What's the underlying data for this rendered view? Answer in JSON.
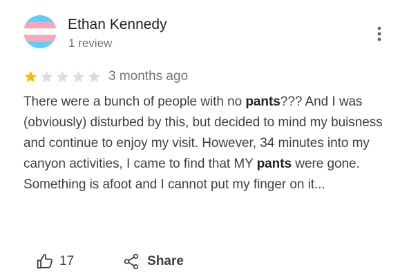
{
  "reviewer": {
    "name": "Ethan Kennedy",
    "review_count": "1 review",
    "avatar_colors": [
      "#5bcefa",
      "#f5a9b8",
      "#ffffff",
      "#f5a9b8",
      "#5bcefa"
    ]
  },
  "review": {
    "rating": 1,
    "max_rating": 5,
    "time_ago": "3 months ago",
    "text_parts": [
      {
        "text": "There were a bunch of people with no ",
        "bold": false
      },
      {
        "text": "pants",
        "bold": true
      },
      {
        "text": "??? And I was (obviously) disturbed by this, but decided to mind my buisness and continue to enjoy my visit. However, 34 minutes into my canyon activities, I came to find that MY ",
        "bold": false
      },
      {
        "text": "pants",
        "bold": true
      },
      {
        "text": " were gone. Something is afoot and I cannot put my finger on it...",
        "bold": false
      }
    ]
  },
  "actions": {
    "like_count": "17",
    "share_label": "Share"
  },
  "icons": {
    "more": "more-vertical-icon",
    "like": "thumbs-up-icon",
    "share": "share-icon",
    "star": "star-icon"
  },
  "colors": {
    "star_filled": "#fbbc04",
    "star_empty": "#dadce0",
    "secondary_text": "#70757a"
  }
}
